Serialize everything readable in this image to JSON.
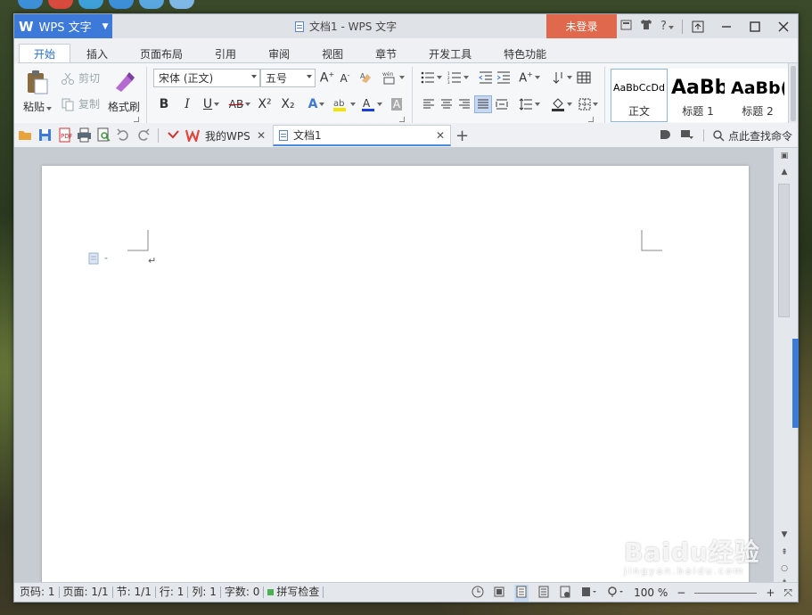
{
  "app": {
    "brand": "WPS 文字",
    "window_title": "文档1 - WPS 文字",
    "login_label": "未登录",
    "help_label": "?"
  },
  "ribbon_tabs": [
    "开始",
    "插入",
    "页面布局",
    "引用",
    "审阅",
    "视图",
    "章节",
    "开发工具",
    "特色功能"
  ],
  "ribbon": {
    "paste_label": "粘贴",
    "cut_label": "剪切",
    "copy_label": "复制",
    "format_painter_label": "格式刷",
    "font_name": "宋体 (正文)",
    "font_size": "五号",
    "bold": "B",
    "italic": "I",
    "underline": "U",
    "strikethrough": "AB",
    "superscript": "X²",
    "subscript": "X₂",
    "styles": [
      {
        "preview": "AaBbCcDd",
        "label": "正文"
      },
      {
        "preview": "AaBb",
        "label": "标题 1"
      },
      {
        "preview": "AaBb(",
        "label": "标题 2"
      }
    ]
  },
  "doc_tabs": {
    "wps_tab": "我的WPS",
    "doc_tab": "文档1",
    "find_command": "点此查找命令"
  },
  "status": {
    "page_num": "页码: 1",
    "pages": "页面: 1/1",
    "section": "节: 1/1",
    "row": "行: 1",
    "col": "列: 1",
    "words": "字数: 0",
    "spell_check": "拼写检查",
    "zoom": "100 %"
  },
  "watermark": {
    "brand": "Baidu经验",
    "url": "jingyan.baidu.com"
  },
  "colors": {
    "brand_blue": "#3c79d8",
    "login_red": "#e0684c"
  }
}
